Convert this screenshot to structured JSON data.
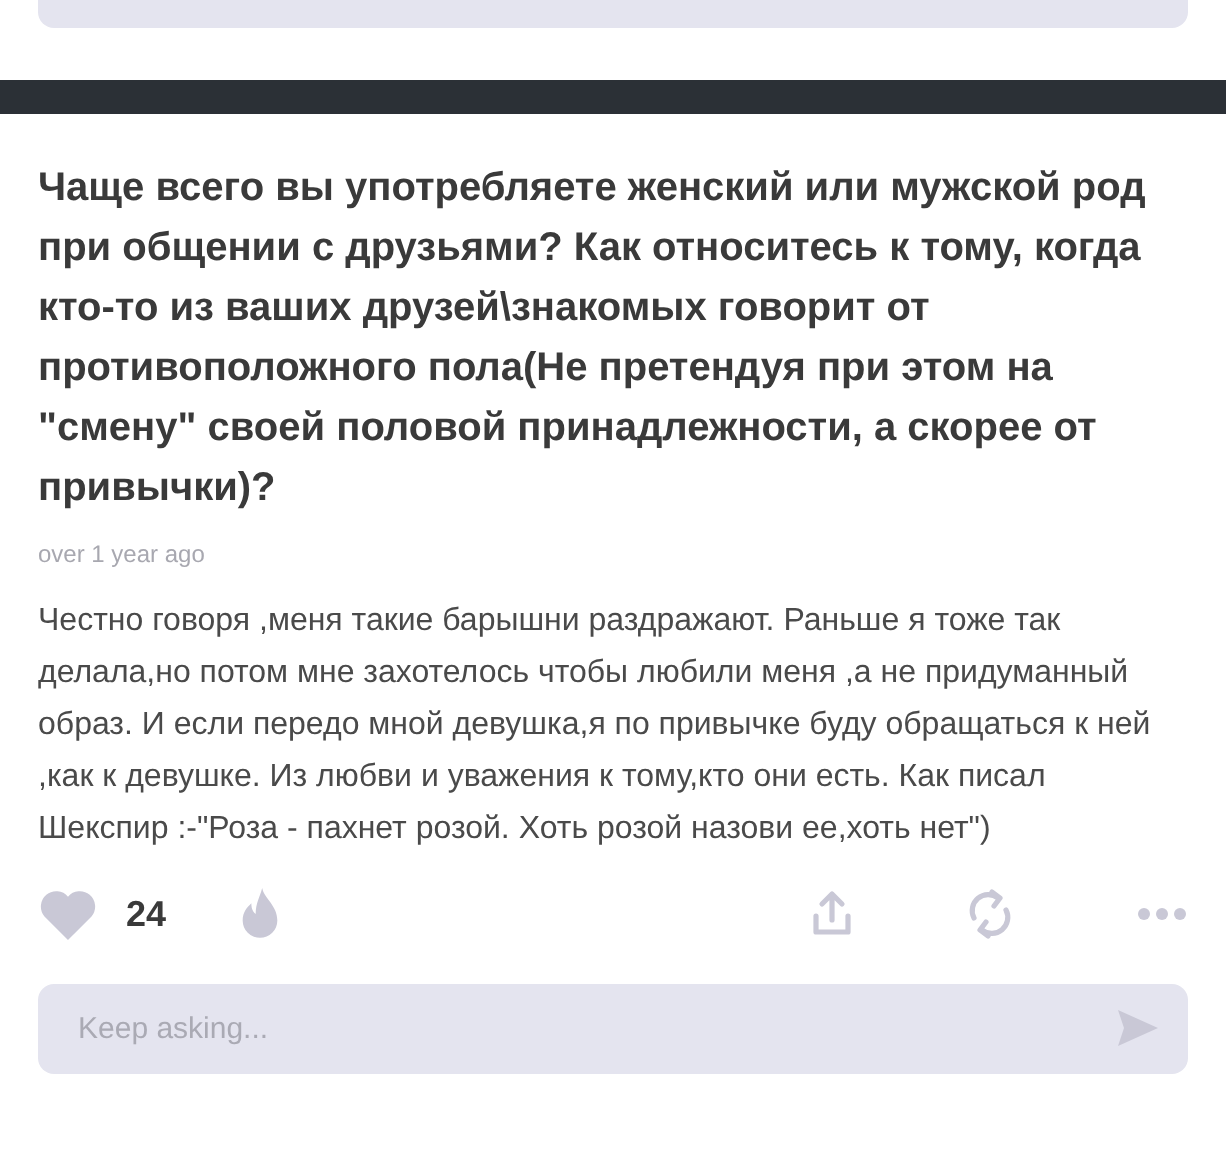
{
  "question": {
    "text": "Чаще всего вы употребляете женский или мужской род при общении с друзьями? Как относитесь к тому, когда кто-то из ваших друзей\\знакомых говорит от противоположного пола(Не претендуя при этом на \"смену\" своей половой принадлежности, а скорее от привычки)?",
    "time": "over 1 year ago",
    "answer": "Честно говоря ,меня такие барышни раздражают. Раньше я тоже так делала,но потом мне захотелось чтобы любили меня ,а не придуманный образ. И если передо мной девушка,я по привычке буду обращаться к ней ,как к девушке. Из любви и уважения к тому,кто они есть. Как писал Шекспир :-\"Роза - пахнет розой. Хоть розой назови ее,хоть нет\")",
    "likes": "24",
    "liked": false,
    "reply": {
      "placeholder": "Keep asking..."
    }
  }
}
